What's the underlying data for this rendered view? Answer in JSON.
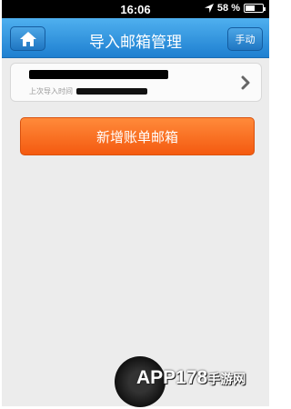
{
  "status_bar": {
    "time": "16:06",
    "battery_text": "58 %",
    "battery_level": 0.58
  },
  "nav": {
    "title": "导入邮箱管理",
    "manual_label": "手动"
  },
  "account": {
    "last_import_label": "上次导入时间"
  },
  "actions": {
    "add_label": "新增账单邮箱"
  },
  "watermark": {
    "text": "APP178",
    "text_cn": "手游网"
  },
  "colors": {
    "nav_blue": "#2a8ae0",
    "accent_orange": "#f66a1c",
    "background": "#ececec"
  }
}
